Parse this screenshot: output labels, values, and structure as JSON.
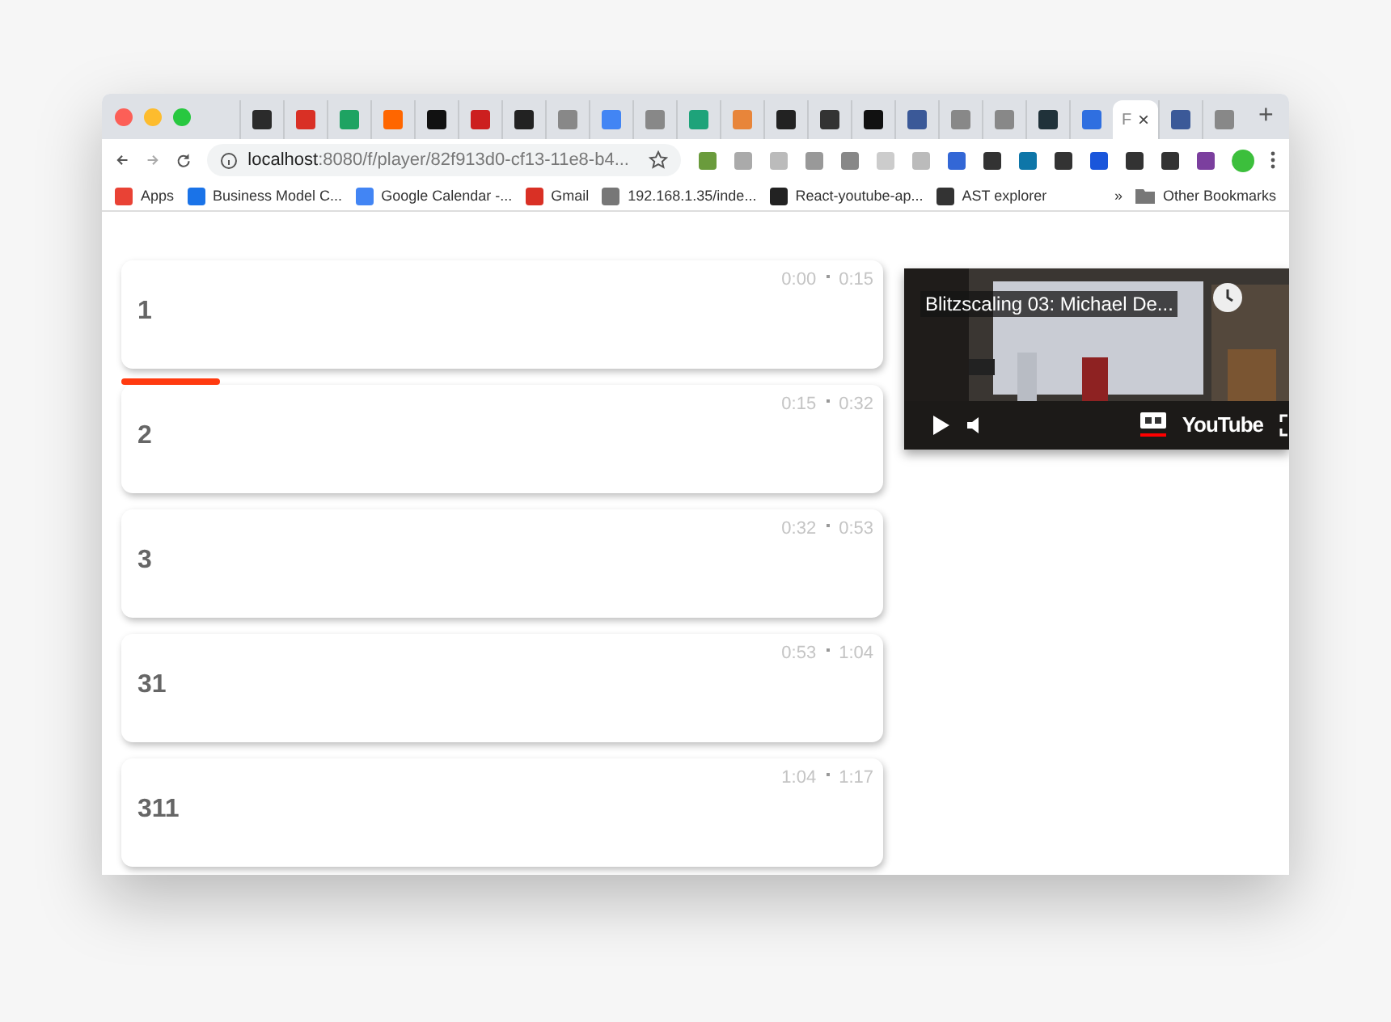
{
  "tabs": [
    {
      "color": "#2b2b2b",
      "selected": false
    },
    {
      "color": "#d93025",
      "selected": false
    },
    {
      "color": "#1ea362",
      "selected": false
    },
    {
      "color": "#ff6600",
      "selected": false
    },
    {
      "color": "#111111",
      "selected": false
    },
    {
      "color": "#cc1f1f",
      "selected": false
    },
    {
      "color": "#222222",
      "selected": false
    },
    {
      "color": "#888888",
      "selected": false
    },
    {
      "color": "#4285f4",
      "selected": false
    },
    {
      "color": "#888888",
      "selected": false
    },
    {
      "color": "#1ea37a",
      "selected": false
    },
    {
      "color": "#e8853a",
      "selected": false
    },
    {
      "color": "#222222",
      "selected": false
    },
    {
      "color": "#333333",
      "selected": false
    },
    {
      "color": "#111111",
      "selected": false
    },
    {
      "color": "#3b5998",
      "selected": false
    },
    {
      "color": "#888888",
      "selected": false
    },
    {
      "color": "#888888",
      "selected": false
    },
    {
      "color": "#20323a",
      "selected": false
    },
    {
      "color": "#2f6fe0",
      "selected": false
    },
    {
      "label": "F",
      "close": "×",
      "color": "#888888",
      "selected": true
    },
    {
      "color": "#3b5998",
      "selected": false
    },
    {
      "color": "#888888",
      "selected": false
    }
  ],
  "new_tab": "+",
  "address": {
    "host": "localhost",
    "path": ":8080/f/player/82f913d0-cf13-11e8-b4..."
  },
  "bookmarks": [
    {
      "label": "Apps",
      "color": "#e94235"
    },
    {
      "label": "Business Model C...",
      "color": "#1a73e8"
    },
    {
      "label": "Google Calendar -...",
      "color": "#4285f4"
    },
    {
      "label": "Gmail",
      "color": "#d93025"
    },
    {
      "label": "192.168.1.35/inde...",
      "color": "#777777"
    },
    {
      "label": "React-youtube-ap...",
      "color": "#222222"
    },
    {
      "label": "AST explorer",
      "color": "#333333"
    }
  ],
  "bookmarks_more": "»",
  "other_bookmarks": "Other Bookmarks",
  "segments": [
    {
      "title": "1",
      "start": "0:00",
      "end": "0:15"
    },
    {
      "title": "2",
      "start": "0:15",
      "end": "0:32",
      "level": 0.13
    },
    {
      "title": "3",
      "start": "0:32",
      "end": "0:53"
    },
    {
      "title": "31",
      "start": "0:53",
      "end": "1:04"
    },
    {
      "title": "311",
      "start": "1:04",
      "end": "1:17"
    }
  ],
  "video": {
    "title": "Blitzscaling 03: Michael De...",
    "logo": "YouTube",
    "captions_on": true
  }
}
